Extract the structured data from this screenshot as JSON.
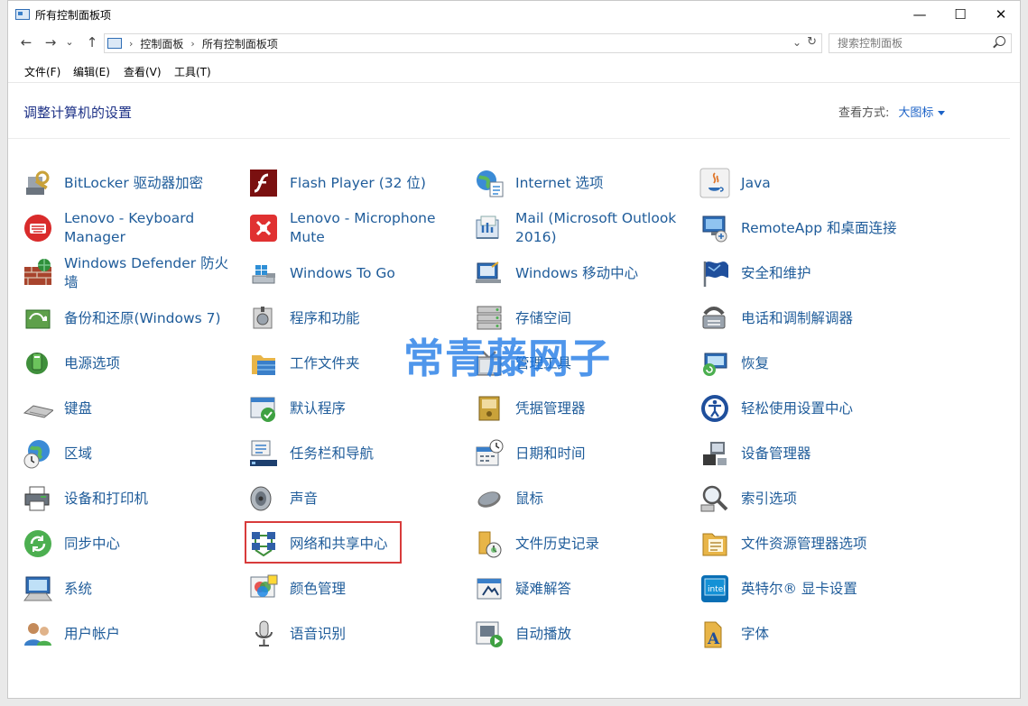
{
  "window": {
    "title": "所有控制面板项",
    "minimize": "—",
    "maximize": "☐",
    "close": "✕"
  },
  "nav": {
    "back": "←",
    "forward": "→",
    "recent": "⌄",
    "up": "↑"
  },
  "address": {
    "crumbs": [
      "控制面板",
      "所有控制面板项"
    ],
    "separator": "›",
    "dropdown": "⌄",
    "refresh": "↻"
  },
  "search": {
    "placeholder": "搜索控制面板"
  },
  "menu": [
    "文件(F)",
    "编辑(E)",
    "查看(V)",
    "工具(T)"
  ],
  "header": {
    "title": "调整计算机的设置",
    "view_label": "查看方式:",
    "view_value": "大图标"
  },
  "items": [
    {
      "label": "BitLocker 驱动器加密",
      "icon": "bitlocker-icon",
      "col": 0,
      "row": 0
    },
    {
      "label": "Flash Player (32 位)",
      "icon": "flash-player-icon",
      "col": 1,
      "row": 0
    },
    {
      "label": "Internet 选项",
      "icon": "internet-options-icon",
      "col": 2,
      "row": 0
    },
    {
      "label": "Java",
      "icon": "java-icon",
      "col": 3,
      "row": 0
    },
    {
      "label": "Lenovo - Keyboard Manager",
      "icon": "lenovo-keyboard-icon",
      "col": 0,
      "row": 1
    },
    {
      "label": "Lenovo - Microphone Mute",
      "icon": "lenovo-microphone-icon",
      "col": 1,
      "row": 1
    },
    {
      "label": "Mail (Microsoft Outlook 2016)",
      "icon": "mail-icon",
      "col": 2,
      "row": 1
    },
    {
      "label": "RemoteApp 和桌面连接",
      "icon": "remoteapp-icon",
      "col": 3,
      "row": 1
    },
    {
      "label": "Windows Defender 防火墙",
      "icon": "firewall-icon",
      "col": 0,
      "row": 2
    },
    {
      "label": "Windows To Go",
      "icon": "windows-to-go-icon",
      "col": 1,
      "row": 2
    },
    {
      "label": "Windows 移动中心",
      "icon": "mobility-center-icon",
      "col": 2,
      "row": 2
    },
    {
      "label": "安全和维护",
      "icon": "security-flag-icon",
      "col": 3,
      "row": 2
    },
    {
      "label": "备份和还原(Windows 7)",
      "icon": "backup-icon",
      "col": 0,
      "row": 3
    },
    {
      "label": "程序和功能",
      "icon": "programs-icon",
      "col": 1,
      "row": 3
    },
    {
      "label": "存储空间",
      "icon": "storage-icon",
      "col": 2,
      "row": 3
    },
    {
      "label": "电话和调制解调器",
      "icon": "phone-modem-icon",
      "col": 3,
      "row": 3
    },
    {
      "label": "电源选项",
      "icon": "power-icon",
      "col": 0,
      "row": 4
    },
    {
      "label": "工作文件夹",
      "icon": "work-folders-icon",
      "col": 1,
      "row": 4
    },
    {
      "label": "管理工具",
      "icon": "admin-tools-icon",
      "col": 2,
      "row": 4
    },
    {
      "label": "恢复",
      "icon": "recovery-icon",
      "col": 3,
      "row": 4
    },
    {
      "label": "键盘",
      "icon": "keyboard-icon",
      "col": 0,
      "row": 5
    },
    {
      "label": "默认程序",
      "icon": "default-programs-icon",
      "col": 1,
      "row": 5
    },
    {
      "label": "凭据管理器",
      "icon": "credential-manager-icon",
      "col": 2,
      "row": 5
    },
    {
      "label": "轻松使用设置中心",
      "icon": "ease-of-access-icon",
      "col": 3,
      "row": 5
    },
    {
      "label": "区域",
      "icon": "region-globe-icon",
      "col": 0,
      "row": 6
    },
    {
      "label": "任务栏和导航",
      "icon": "taskbar-icon",
      "col": 1,
      "row": 6
    },
    {
      "label": "日期和时间",
      "icon": "date-time-icon",
      "col": 2,
      "row": 6
    },
    {
      "label": "设备管理器",
      "icon": "device-manager-icon",
      "col": 3,
      "row": 6
    },
    {
      "label": "设备和打印机",
      "icon": "printer-icon",
      "col": 0,
      "row": 7
    },
    {
      "label": "声音",
      "icon": "speaker-icon",
      "col": 1,
      "row": 7
    },
    {
      "label": "鼠标",
      "icon": "mouse-icon",
      "col": 2,
      "row": 7
    },
    {
      "label": "索引选项",
      "icon": "indexing-icon",
      "col": 3,
      "row": 7
    },
    {
      "label": "同步中心",
      "icon": "sync-icon",
      "col": 0,
      "row": 8
    },
    {
      "label": "网络和共享中心",
      "icon": "network-icon",
      "col": 1,
      "row": 8
    },
    {
      "label": "文件历史记录",
      "icon": "file-history-icon",
      "col": 2,
      "row": 8
    },
    {
      "label": "文件资源管理器选项",
      "icon": "explorer-options-icon",
      "col": 3,
      "row": 8
    },
    {
      "label": "系统",
      "icon": "system-monitor-icon",
      "col": 0,
      "row": 9
    },
    {
      "label": "颜色管理",
      "icon": "color-management-icon",
      "col": 1,
      "row": 9
    },
    {
      "label": "疑难解答",
      "icon": "troubleshooting-icon",
      "col": 2,
      "row": 9
    },
    {
      "label": "英特尔® 显卡设置",
      "icon": "intel-graphics-icon",
      "col": 3,
      "row": 9
    },
    {
      "label": "用户帐户",
      "icon": "user-accounts-icon",
      "col": 0,
      "row": 10
    },
    {
      "label": "语音识别",
      "icon": "microphone-icon",
      "col": 1,
      "row": 10
    },
    {
      "label": "自动播放",
      "icon": "autoplay-icon",
      "col": 2,
      "row": 10
    },
    {
      "label": "字体",
      "icon": "fonts-icon",
      "col": 3,
      "row": 10
    }
  ],
  "highlighted_item": "网络和共享中心",
  "watermark": "常青藤网子"
}
